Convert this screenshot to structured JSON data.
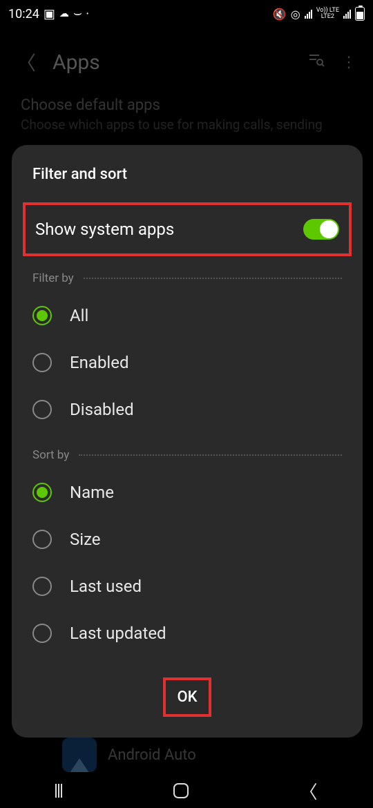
{
  "status": {
    "time": "10:24",
    "lte_top": "Vo)) LTE",
    "lte_bottom": "LTE2"
  },
  "background": {
    "title": "Apps",
    "subtitle": "Choose default apps",
    "subtitle2": "Choose which apps to use for making calls, sending",
    "app_name": "Android Auto"
  },
  "dialog": {
    "title": "Filter and sort",
    "show_system_label": "Show system apps",
    "show_system_on": true,
    "filter_by_label": "Filter by",
    "filter_options": {
      "all": "All",
      "enabled": "Enabled",
      "disabled": "Disabled"
    },
    "filter_selected": "all",
    "sort_by_label": "Sort by",
    "sort_options": {
      "name": "Name",
      "size": "Size",
      "last_used": "Last used",
      "last_updated": "Last updated"
    },
    "sort_selected": "name",
    "ok_label": "OK"
  }
}
